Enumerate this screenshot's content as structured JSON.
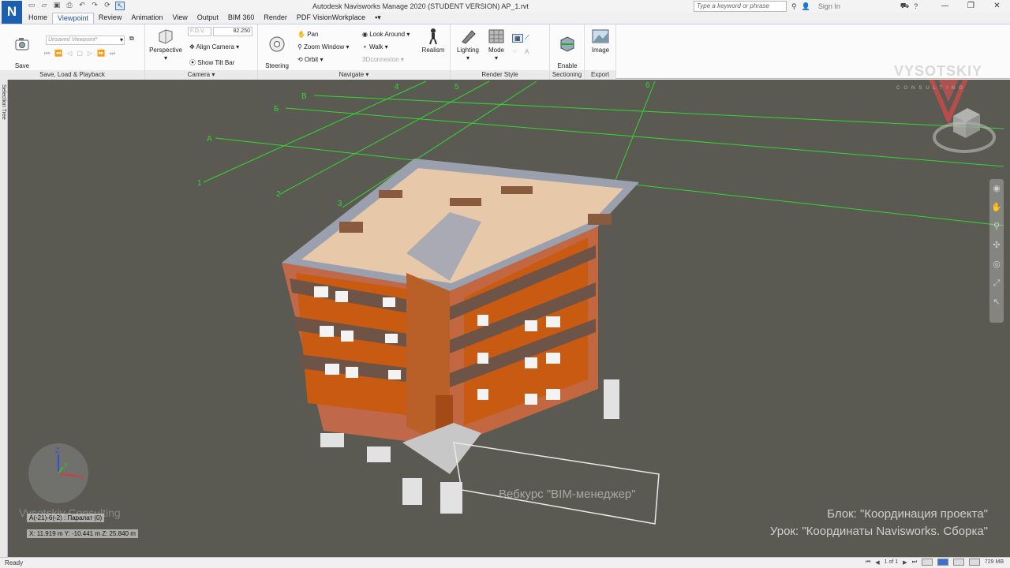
{
  "titlebar": {
    "app_letter": "N",
    "title": "Autodesk Navisworks Manage 2020 (STUDENT VERSION)    AP_1.rvt",
    "search_placeholder": "Type a keyword or phrase",
    "sign_in": "Sign In"
  },
  "tabs": [
    "Home",
    "Viewpoint",
    "Review",
    "Animation",
    "View",
    "Output",
    "BIM 360",
    "Render",
    "PDF VisionWorkplace"
  ],
  "ribbon": {
    "save_viewpoint": "Save\nViewpoint",
    "viewpoint_combo": "Unsaved Viewpoint*",
    "fov_value": "F.O.V.",
    "fov_number": "82.250",
    "perspective": "Perspective",
    "align_camera": "Align Camera",
    "show_tilt_bar": "Show Tilt Bar",
    "steering_wheels": "Steering\nWheels",
    "pan": "Pan",
    "zoom_window": "Zoom Window",
    "orbit": "Orbit",
    "look_around": "Look Around",
    "walk": "Walk",
    "connexion": "3Dconnexion",
    "realism": "Realism",
    "lighting": "Lighting",
    "mode": "Mode",
    "enable_sectioning": "Enable\nSectioning",
    "image": "Image",
    "panels": {
      "save_load": "Save, Load & Playback",
      "camera": "Camera",
      "navigate": "Navigate",
      "render_style": "Render Style",
      "sectioning": "Sectioning",
      "export": "Export"
    }
  },
  "viewport": {
    "side_tab": "Selection Tree",
    "brand_name": "VYSOTSKIY",
    "brand_sub": "CONSULTING",
    "block_line": "Блок: \"Координация проекта\"",
    "lesson_line": "Урок: \"Координаты Navisworks. Сборка\"",
    "consult_watermark": "Vysotskiy Consulting",
    "course_watermark": "Вебкурс \"BIM-менеджер\"",
    "grid_readout": "A(-21)-6(-2) : Паралат (0)",
    "xyz_readout": "X: 11.919 m  Y: -10.441 m  Z: 25.840 m",
    "grid_labels": {
      "letters": [
        "А",
        "Б",
        "В"
      ],
      "numbers": [
        "1",
        "2",
        "3",
        "4",
        "5",
        "6"
      ]
    },
    "axis": {
      "x": "X",
      "y": "Y",
      "z": "Z"
    }
  },
  "statusbar": {
    "status": "Ready",
    "page": "1 of 1",
    "memory": "729 MB"
  },
  "colors": {
    "viewport_bg": "#5a5a52",
    "grid_green": "#33d633",
    "brick": "#c0694a",
    "orange_wall": "#c85a12",
    "roof": "#e7c9aa"
  }
}
